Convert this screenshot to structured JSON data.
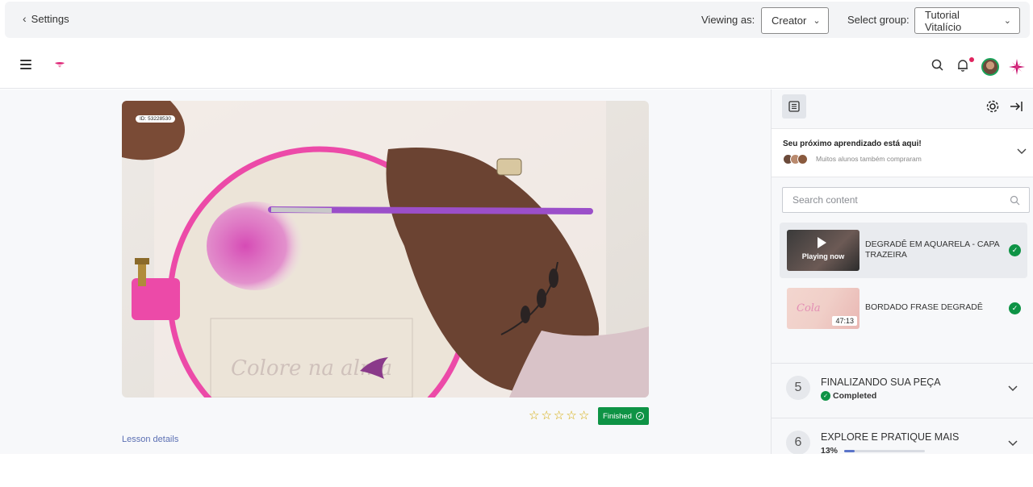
{
  "admin_bar": {
    "back_label": "Settings",
    "viewing_label": "Viewing as:",
    "viewing_value": "Creator",
    "group_label": "Select group:",
    "group_value": "Tutorial Vitalício"
  },
  "header": {
    "icons": [
      "menu-icon",
      "logo-icon",
      "search-icon",
      "bell-icon",
      "avatar",
      "brand-star-icon"
    ]
  },
  "video": {
    "id_badge": "ID: 53228530"
  },
  "lesson": {
    "rating_stars": 0,
    "rating_max": 5,
    "finished_label": "Finished",
    "details_link": "Lesson details"
  },
  "sidebar": {
    "next_title": "Seu próximo aprendizado está aqui!",
    "next_subtitle": "Muitos alunos também compraram",
    "search_placeholder": "Search content",
    "lessons": [
      {
        "title": "DEGRADÊ EM AQUARELA - CAPA TRAZEIRA",
        "thumb_label": "Playing now",
        "active": true,
        "completed": true
      },
      {
        "title": "BORDADO FRASE DEGRADÊ",
        "duration": "47:13",
        "thumb_script": "Cola",
        "active": false,
        "completed": true
      }
    ],
    "modules": [
      {
        "number": "5",
        "title": "FINALIZANDO SUA PEÇA",
        "status": "Completed"
      },
      {
        "number": "6",
        "title": "EXPLORE E PRATIQUE MAIS",
        "progress_text": "13%",
        "progress": 0.13
      }
    ]
  },
  "colors": {
    "success": "#0e9345",
    "accent": "#5b74c9",
    "brand_pink": "#d81b7a"
  }
}
